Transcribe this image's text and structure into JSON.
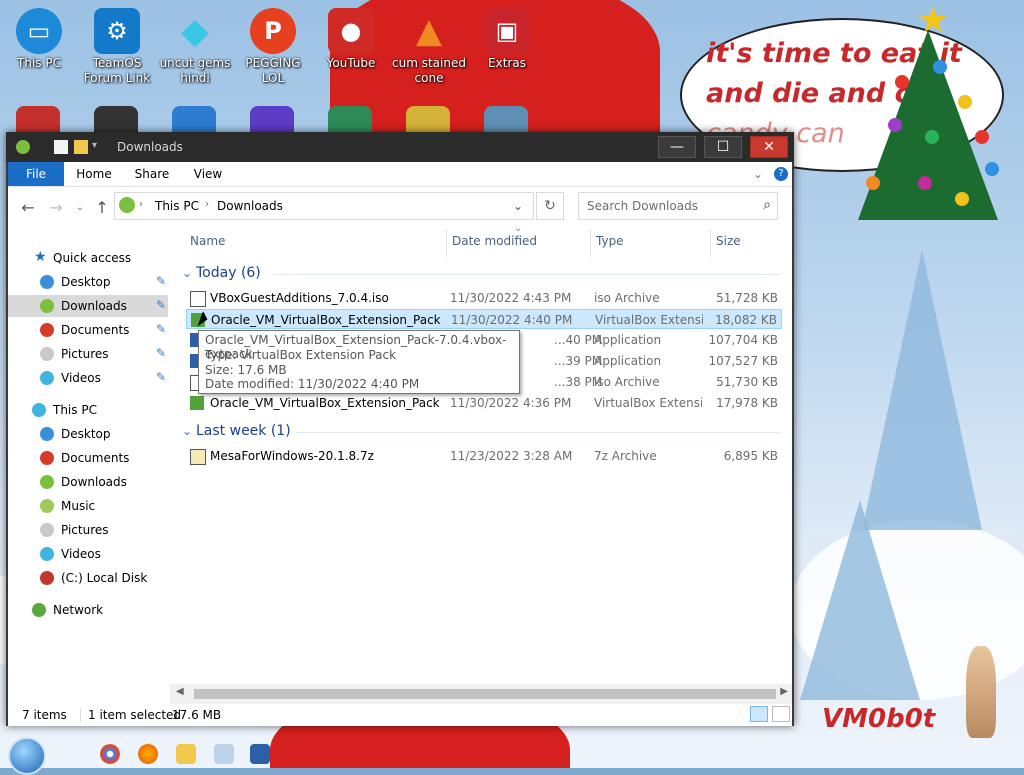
{
  "desktop": {
    "icons": [
      {
        "label": "This PC",
        "icon": "monitor-icon",
        "color": "#1e88d9"
      },
      {
        "label": "TeamOS Forum Link",
        "icon": "gear-icon",
        "color": "#1479c9"
      },
      {
        "label": "uncut gems hindi",
        "icon": "diamond-icon",
        "color": "#3cc6e6"
      },
      {
        "label": "PEGGING LOL",
        "icon": "p-logo-icon",
        "color": "#e6401f"
      },
      {
        "label": "YouTube",
        "icon": "angry-bird-icon",
        "color": "#cf2a25"
      },
      {
        "label": "cum stained cone",
        "icon": "traffic-cone-icon",
        "color": "#f08a22"
      },
      {
        "label": "Extras",
        "icon": "gift-box-icon",
        "color": "#c8242a"
      }
    ],
    "wallpaper": {
      "bubble_text": [
        "it's time to eat it",
        "and die and c",
        "candy can"
      ],
      "signature": "VM0b0t"
    }
  },
  "window": {
    "title": "Downloads",
    "buttons": {
      "minimize": "—",
      "maximize": "☐",
      "close": "✕"
    },
    "ribbon_tabs": [
      "File",
      "Home",
      "Share",
      "View"
    ],
    "address": {
      "crumbs": [
        "This PC",
        "Downloads"
      ]
    },
    "search": {
      "placeholder": "Search Downloads"
    },
    "nav": {
      "quick_access_label": "Quick access",
      "quick_access": [
        {
          "label": "Desktop",
          "pinned": true
        },
        {
          "label": "Downloads",
          "pinned": true,
          "selected": true
        },
        {
          "label": "Documents",
          "pinned": true
        },
        {
          "label": "Pictures",
          "pinned": true
        },
        {
          "label": "Videos",
          "pinned": true
        }
      ],
      "this_pc_label": "This PC",
      "this_pc": [
        {
          "label": "Desktop"
        },
        {
          "label": "Documents"
        },
        {
          "label": "Downloads"
        },
        {
          "label": "Music"
        },
        {
          "label": "Pictures"
        },
        {
          "label": "Videos"
        },
        {
          "label": "(C:) Local Disk"
        }
      ],
      "network_label": "Network"
    },
    "columns": {
      "name": "Name",
      "date": "Date modified",
      "type": "Type",
      "size": "Size"
    },
    "groups": [
      {
        "label": "Today (6)",
        "files": [
          {
            "name": "VBoxGuestAdditions_7.0.4.iso",
            "date": "11/30/2022 4:43 PM",
            "type": "iso Archive",
            "size": "51,728 KB",
            "icon": "iso-file-icon"
          },
          {
            "name": "Oracle_VM_VirtualBox_Extension_Pack-7....",
            "date": "11/30/2022 4:40 PM",
            "type": "VirtualBox Extensi...",
            "size": "18,082 KB",
            "icon": "vbox-extpack-icon",
            "selected": true
          },
          {
            "name": "",
            "date": "...40 PM",
            "type": "Application",
            "size": "107,704 KB",
            "icon": "vbox-app-icon"
          },
          {
            "name": "",
            "date": "...39 PM",
            "type": "Application",
            "size": "107,527 KB",
            "icon": "vbox-app-icon"
          },
          {
            "name": "",
            "date": "...38 PM",
            "type": "iso Archive",
            "size": "51,730 KB",
            "icon": "iso-file-icon"
          },
          {
            "name": "Oracle_VM_VirtualBox_Extension_Pack-7....",
            "date": "11/30/2022 4:36 PM",
            "type": "VirtualBox Extensi...",
            "size": "17,978 KB",
            "icon": "vbox-extpack-icon"
          }
        ]
      },
      {
        "label": "Last week (1)",
        "files": [
          {
            "name": "MesaForWindows-20.1.8.7z",
            "date": "11/23/2022 3:28 AM",
            "type": "7z Archive",
            "size": "6,895 KB",
            "icon": "7z-archive-icon"
          }
        ]
      }
    ],
    "tooltip": {
      "line1": "Oracle_VM_VirtualBox_Extension_Pack-7.0.4.vbox-extpack",
      "line2": "Type: VirtualBox Extension Pack",
      "line3": "Size: 17.6 MB",
      "line4": "Date modified: 11/30/2022 4:40 PM"
    },
    "status": {
      "count": "7 items",
      "selection": "1 item selected",
      "size": "17.6 MB"
    }
  },
  "taskbar": {
    "items": [
      "start-orb-icon",
      "chrome-icon",
      "firefox-icon",
      "file-explorer-icon",
      "network-monitor-icon",
      "virtualbox-icon"
    ]
  },
  "colors": {
    "accent": "#1a6ec7",
    "selection": "#cce8ff",
    "close": "#c9392d",
    "titlebar": "#2b2b2b"
  }
}
